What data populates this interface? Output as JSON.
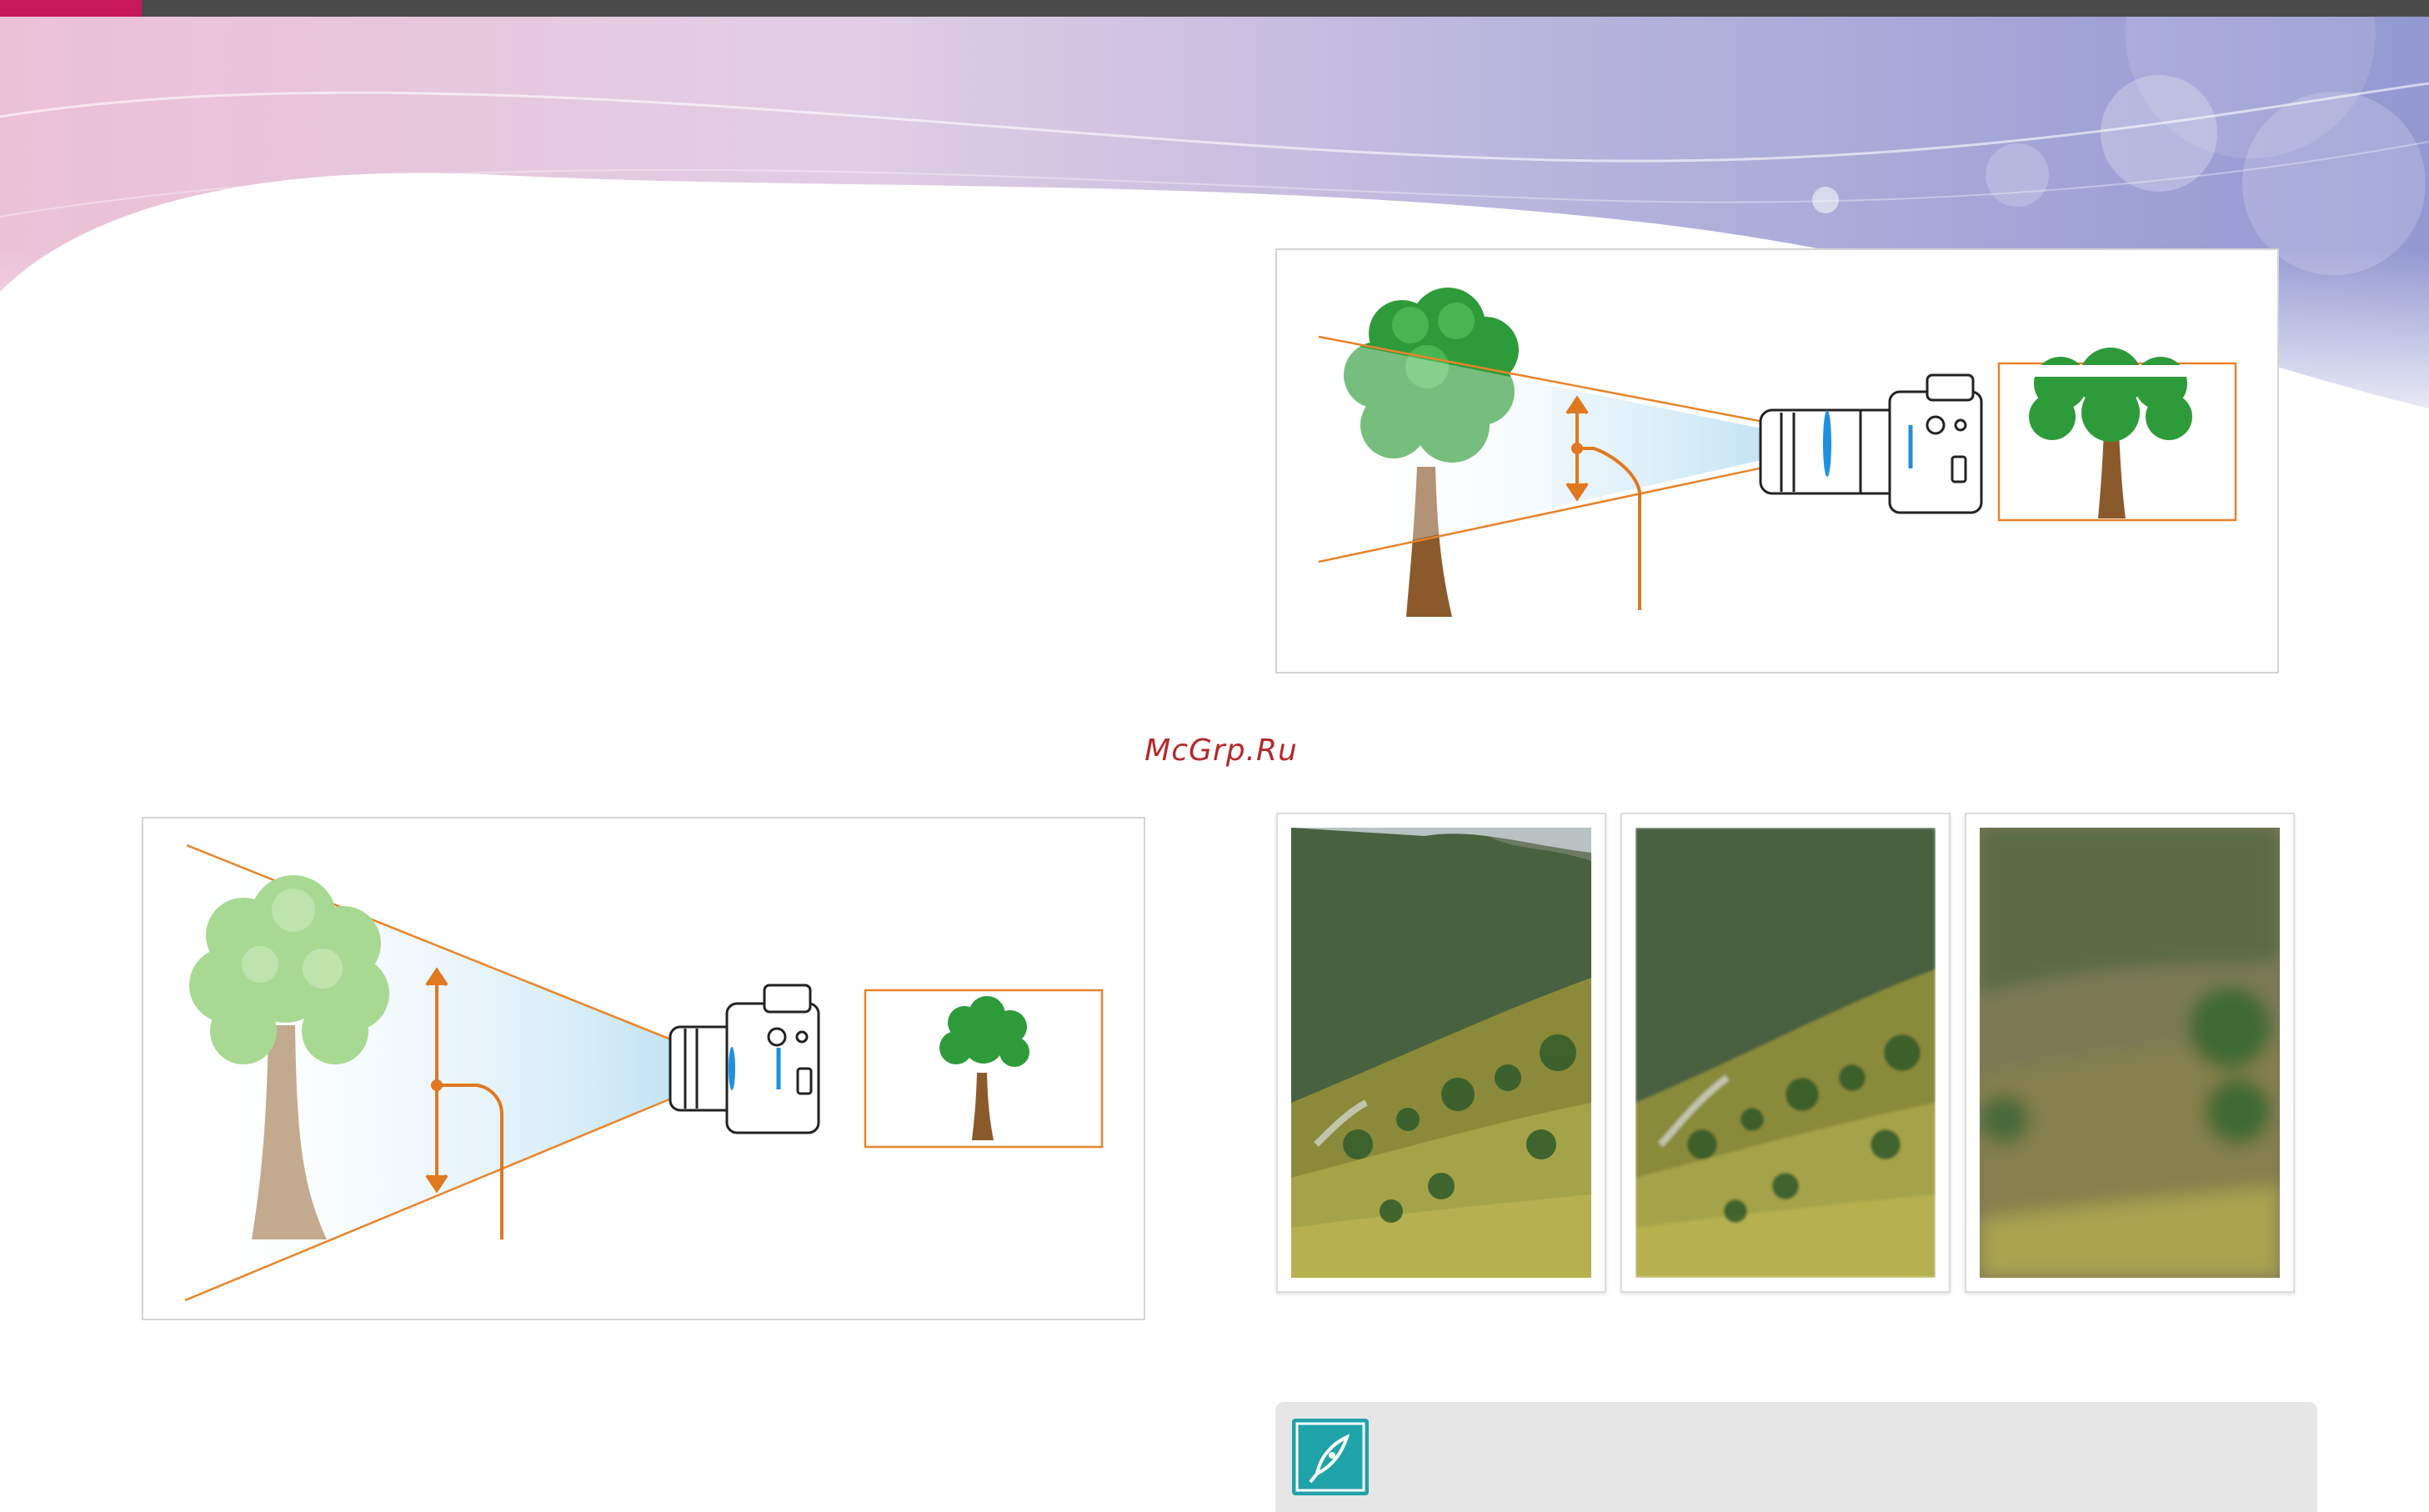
{
  "header": {
    "accent_color": "#c8185a",
    "bar_color": "#4a4a4a"
  },
  "watermark": {
    "text": "McGrp.Ru",
    "color": "#b52a2a"
  },
  "diagrams": {
    "telephoto": {
      "icon": "camera-with-long-lens-icon"
    },
    "wide_angle": {
      "icon": "camera-with-short-lens-icon"
    }
  },
  "photos": [
    {
      "name": "sample-photo-sharp",
      "icon": "landscape-photo"
    },
    {
      "name": "sample-photo-slight-blur",
      "icon": "landscape-photo"
    },
    {
      "name": "sample-photo-heavy-blur",
      "icon": "landscape-photo"
    }
  ],
  "note": {
    "icon": "pen-nib-icon",
    "icon_color": "#1fa3a8"
  }
}
